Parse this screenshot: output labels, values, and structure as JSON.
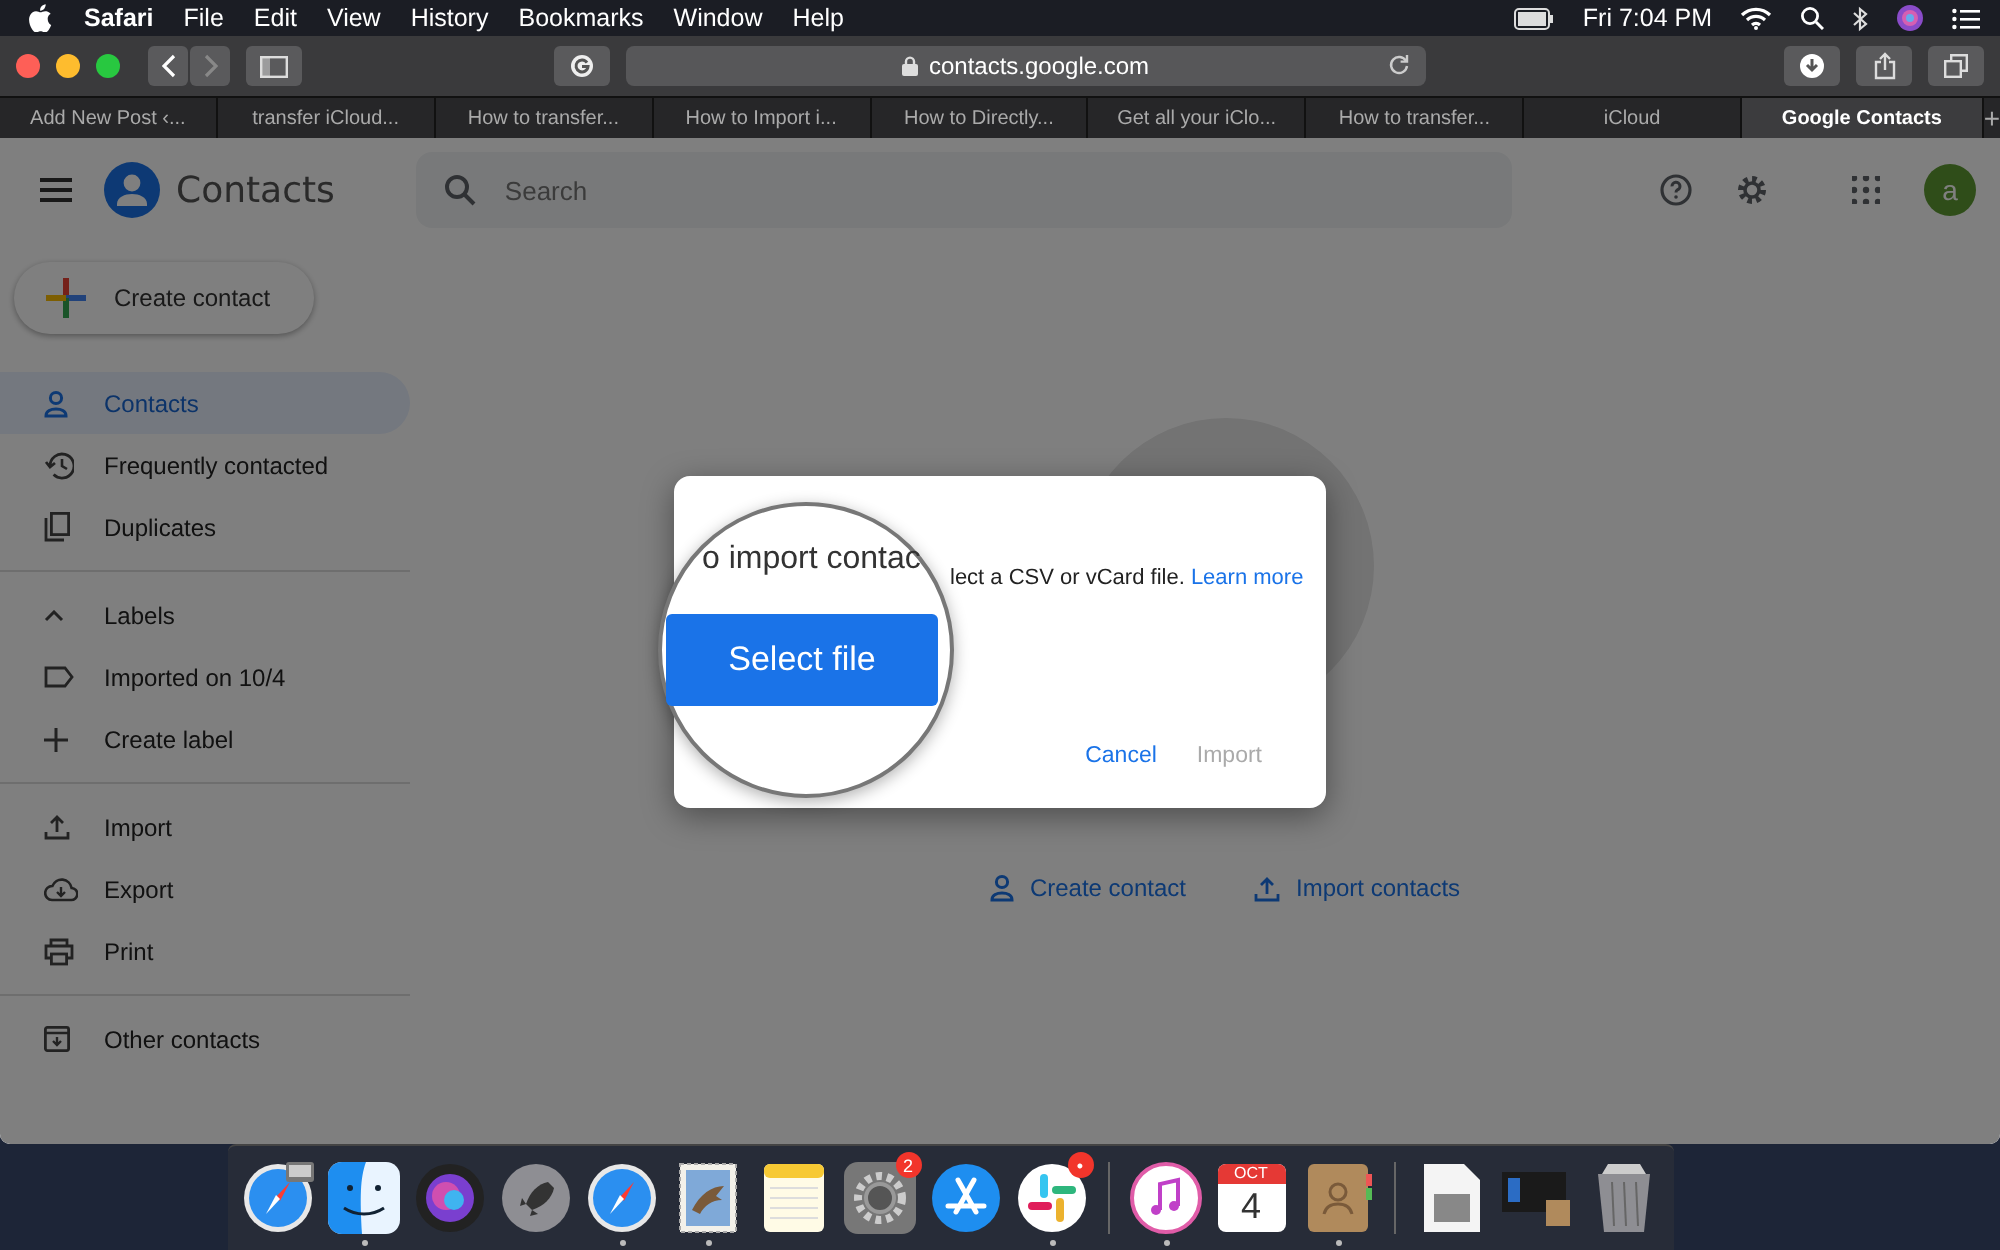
{
  "menu_bar": {
    "app": "Safari",
    "items": [
      "File",
      "Edit",
      "View",
      "History",
      "Bookmarks",
      "Window",
      "Help"
    ],
    "clock": "Fri 7:04 PM"
  },
  "toolbar": {
    "address": "contacts.google.com"
  },
  "tabs": [
    {
      "label": "Add New Post ‹...",
      "selected": false
    },
    {
      "label": "transfer iCloud...",
      "selected": false
    },
    {
      "label": "How to transfer...",
      "selected": false
    },
    {
      "label": "How to Import i...",
      "selected": false
    },
    {
      "label": "How to Directly...",
      "selected": false
    },
    {
      "label": "Get all your iClo...",
      "selected": false
    },
    {
      "label": "How to transfer...",
      "selected": false
    },
    {
      "label": "iCloud",
      "selected": false
    },
    {
      "label": "Google Contacts",
      "selected": true
    }
  ],
  "new_tab": "+",
  "contacts_app": {
    "title": "Contacts",
    "search_placeholder": "Search",
    "avatar_letter": "a",
    "create_button": "Create contact",
    "nav_groups": [
      [
        {
          "label": "Contacts",
          "kind": "link",
          "selected": true
        },
        {
          "label": "Frequently contacted",
          "kind": "link",
          "selected": false
        },
        {
          "label": "Duplicates",
          "kind": "link",
          "selected": false
        }
      ],
      [
        {
          "label": "Labels",
          "kind": "header",
          "expanded": true,
          "selected": false
        },
        {
          "label": "Imported on 10/4",
          "kind": "link",
          "selected": false
        },
        {
          "label": "Create label",
          "kind": "link",
          "selected": false
        }
      ],
      [
        {
          "label": "Import",
          "kind": "link",
          "selected": false
        },
        {
          "label": "Export",
          "kind": "link",
          "selected": false
        },
        {
          "label": "Print",
          "kind": "link",
          "selected": false
        }
      ],
      [
        {
          "label": "Other contacts",
          "kind": "link",
          "selected": false
        }
      ]
    ],
    "empty_actions": [
      "Create contact",
      "Import contacts"
    ]
  },
  "dialog": {
    "lens_heading": "o import contac",
    "body": "lect a CSV or vCard file.",
    "link": "Learn more",
    "select_button": "Select file",
    "buttons": [
      {
        "label": "Cancel",
        "disabled": false
      },
      {
        "label": "Import",
        "disabled": true
      }
    ]
  },
  "dock": [
    {
      "kind": "handoff",
      "running": false
    },
    {
      "kind": "finder",
      "running": true
    },
    {
      "kind": "siri",
      "running": false
    },
    {
      "kind": "launchpad",
      "running": false
    },
    {
      "kind": "safari",
      "running": true
    },
    {
      "kind": "mail",
      "running": true
    },
    {
      "kind": "notes",
      "running": false
    },
    {
      "kind": "settings",
      "running": false,
      "badge": "2"
    },
    {
      "kind": "appstore",
      "running": false
    },
    {
      "kind": "slack",
      "running": true,
      "badge": "•"
    },
    {
      "kind": "separator"
    },
    {
      "kind": "music",
      "running": true
    },
    {
      "kind": "calendar",
      "running": false,
      "month": "OCT",
      "day": "4"
    },
    {
      "kind": "addressbook",
      "running": true
    },
    {
      "kind": "separator"
    },
    {
      "kind": "document",
      "running": false
    },
    {
      "kind": "screenshot",
      "running": false
    },
    {
      "kind": "trash",
      "running": false
    }
  ]
}
